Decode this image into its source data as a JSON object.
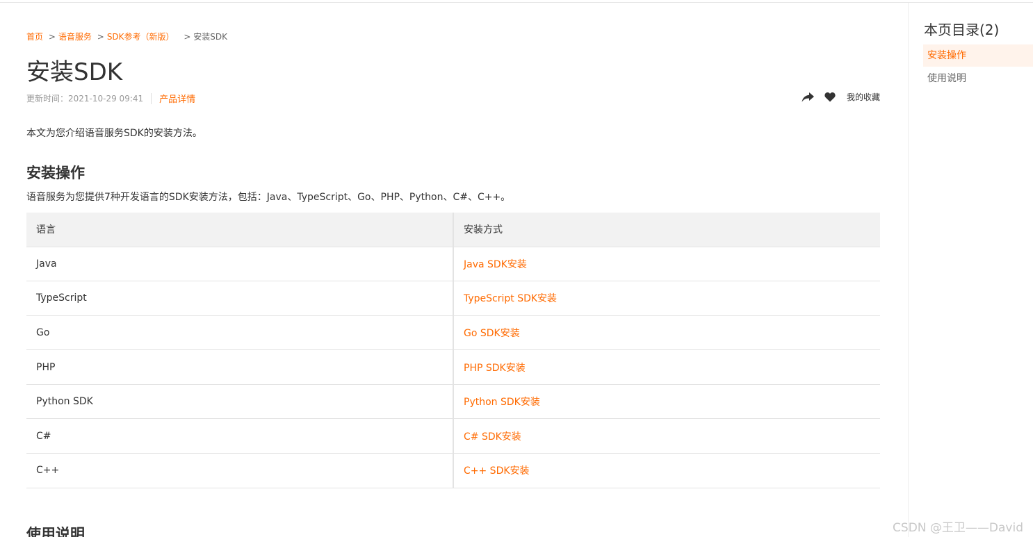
{
  "breadcrumb": {
    "items": [
      "首页",
      "语音服务",
      "SDK参考（新版）"
    ],
    "separator": ">",
    "current": "安装SDK"
  },
  "page": {
    "title": "安装SDK",
    "updated": "更新时间：2021-10-29 09:41",
    "product_link": "产品详情",
    "favorite_label": "我的收藏",
    "intro": "本文为您介绍语音服务SDK的安装方法。"
  },
  "sections": {
    "install": {
      "heading": "安装操作",
      "desc": "语音服务为您提供7种开发语言的SDK安装方法，包括：Java、TypeScript、Go、PHP、Python、C#、C++。"
    },
    "usage": {
      "heading": "使用说明"
    }
  },
  "table": {
    "headers": [
      "语言",
      "安装方式"
    ],
    "rows": [
      [
        "Java",
        "Java SDK安装"
      ],
      [
        "TypeScript",
        "TypeScript SDK安装"
      ],
      [
        "Go",
        "Go SDK安装"
      ],
      [
        "PHP",
        "PHP SDK安装"
      ],
      [
        "Python SDK",
        "Python SDK安装"
      ],
      [
        "C#",
        "C# SDK安装"
      ],
      [
        "C++",
        "C++ SDK安装"
      ]
    ]
  },
  "toc": {
    "title": "本页目录(2)",
    "items": [
      "安装操作",
      "使用说明"
    ],
    "active_index": 0
  },
  "watermark": "CSDN @王卫——David",
  "colors": {
    "accent": "#ff6a00",
    "text": "#333333",
    "muted": "#999999",
    "header_bg": "#f2f2f2",
    "toc_active_bg": "#fff3eb"
  },
  "icons": [
    "share-icon",
    "heart-icon"
  ]
}
